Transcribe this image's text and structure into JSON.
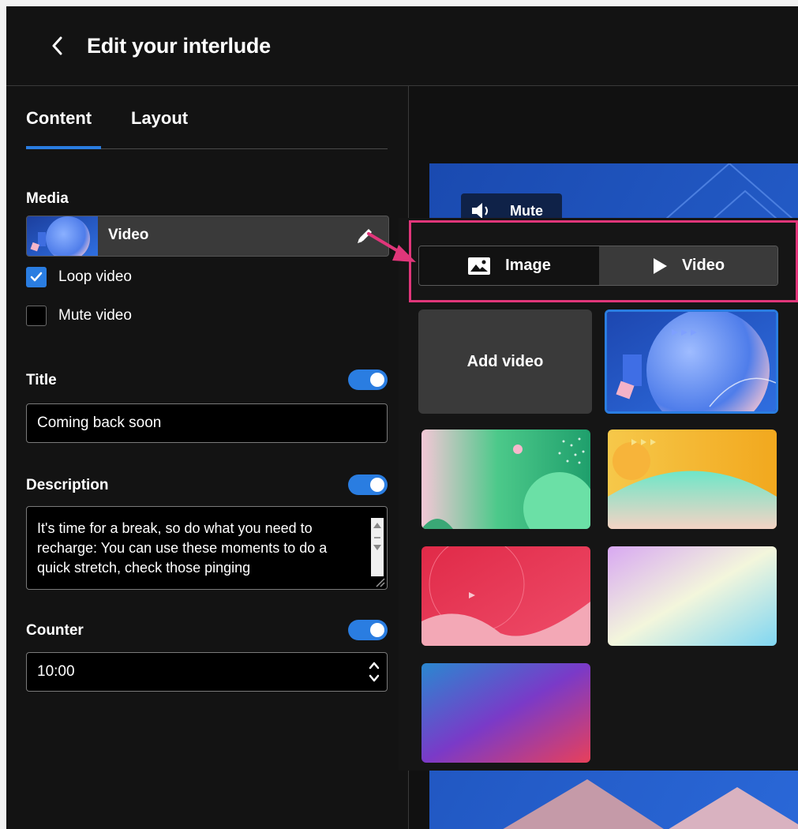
{
  "header": {
    "title": "Edit your interlude"
  },
  "tabs": [
    {
      "label": "Content"
    },
    {
      "label": "Layout"
    }
  ],
  "media": {
    "section_label": "Media",
    "current_label": "Video",
    "loop_label": "Loop video",
    "loop_checked": true,
    "mute_label": "Mute video",
    "mute_checked": false
  },
  "title_field": {
    "label": "Title",
    "enabled": true,
    "value": "Coming back soon"
  },
  "description_field": {
    "label": "Description",
    "enabled": true,
    "value": "It's time for a break, so do what you need to recharge: You can use these moments to do a quick stretch, check those pinging"
  },
  "counter_field": {
    "label": "Counter",
    "enabled": true,
    "value": "10:00"
  },
  "preview": {
    "mute_label": "Mute"
  },
  "media_picker": {
    "segments": [
      {
        "label": "Image",
        "icon": "image-icon",
        "selected": false
      },
      {
        "label": "Video",
        "icon": "play-icon",
        "selected": true
      }
    ],
    "add_video_label": "Add video",
    "selected_tile": "blue-circle"
  },
  "colors": {
    "accent": "#2a7de1",
    "highlight": "#e0367a",
    "background": "#131313"
  }
}
